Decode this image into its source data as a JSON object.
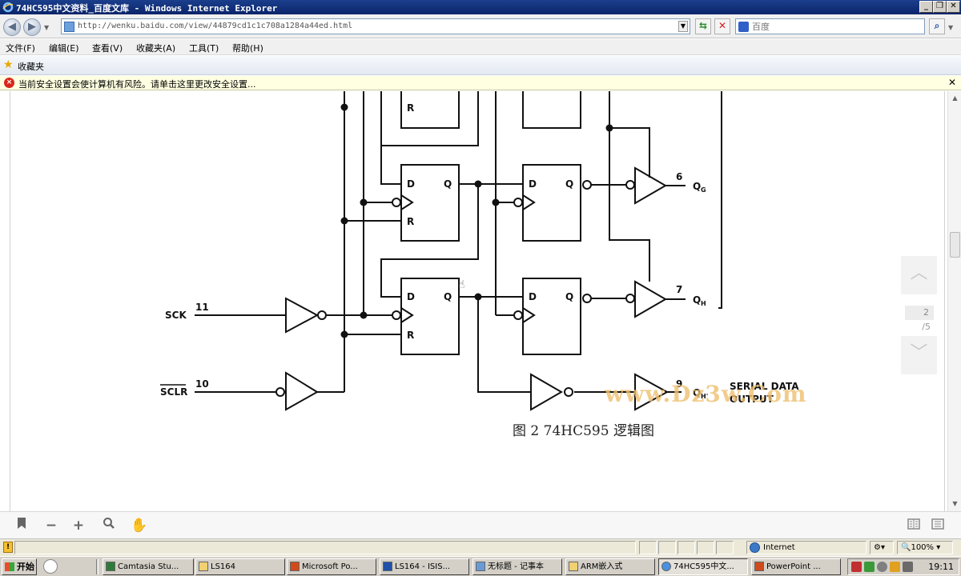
{
  "window": {
    "title": "74HC595中文资料_百度文库 - Windows Internet Explorer"
  },
  "address": {
    "url": "http://wenku.baidu.com/view/44879cd1c1c708a1284a44ed.html"
  },
  "search": {
    "placeholder": "百度"
  },
  "menu": [
    "文件(F)",
    "编辑(E)",
    "查看(V)",
    "收藏夹(A)",
    "工具(T)",
    "帮助(H)"
  ],
  "favorites": {
    "label": "收藏夹"
  },
  "infobar": {
    "message": "当前安全设置会使计算机有风险。请单击这里更改安全设置..."
  },
  "document": {
    "caption": "图 2 74HC595 逻辑图",
    "watermark": "www.Dz3w.Com",
    "pins": [
      {
        "label": "SCK",
        "number": "11"
      },
      {
        "label": "SCLR",
        "number": "10"
      }
    ],
    "outputs": [
      {
        "number": "6",
        "label": "Q",
        "sub": "G"
      },
      {
        "number": "7",
        "label": "Q",
        "sub": "H"
      },
      {
        "number": "9",
        "label": "Q",
        "sub": "H'"
      }
    ],
    "serial_output": [
      "SERIAL DATA",
      "OUTPUT"
    ],
    "ff_labels": {
      "d": "D",
      "q": "Q",
      "r": "R"
    }
  },
  "pagination": {
    "current": "2",
    "total": "/5"
  },
  "statusbar": {
    "zone": "Internet",
    "zoom": "100%"
  },
  "taskbar": {
    "start": "开始",
    "tasks": [
      "Camtasia Stu...",
      "LS164",
      "Microsoft Po...",
      "LS164 - ISIS...",
      "无标题 - 记事本",
      "ARM嵌入式",
      "74HC595中文...",
      "PowerPoint ..."
    ],
    "clock": "19:11"
  }
}
